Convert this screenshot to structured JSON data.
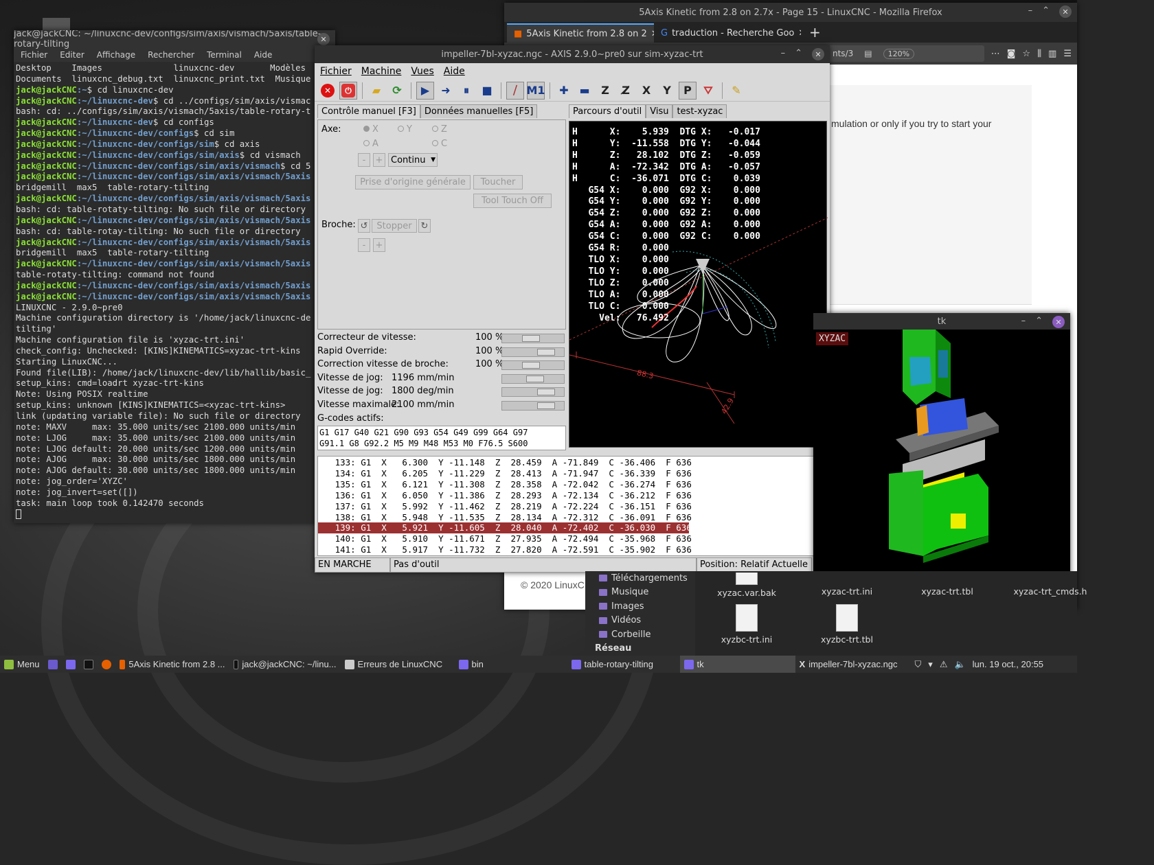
{
  "firefox": {
    "title": "5Axis Kinetic from 2.8 on 2.7x - Page 15 - LinuxCNC - Mozilla Firefox",
    "tabs": [
      "5Axis Kinetic from 2.8 on 2",
      "traduction - Recherche Goo"
    ],
    "url_fragment": "nts/3",
    "zoom": "120%",
    "body_text": "mulation or only if you try to start your",
    "footer": "© 2020 LinuxC"
  },
  "terminal": {
    "title": "jack@jackCNC: ~/linuxcnc-dev/configs/sim/axis/vismach/5axis/table-rotary-tilting",
    "menu": [
      "Fichier",
      "Editer",
      "Affichage",
      "Rechercher",
      "Terminal",
      "Aide"
    ],
    "lines": [
      {
        "t": "Desktop    Images              linuxcnc-dev       Modèles"
      },
      {
        "t": "Documents  linuxcnc_debug.txt  linuxcnc_print.txt  Musique"
      },
      {
        "p": "jack@jackCNC",
        "d": ":~",
        "c": "$ cd linuxcnc-dev"
      },
      {
        "p": "jack@jackCNC",
        "d": ":~/linuxcnc-dev",
        "c": "$ cd ../configs/sim/axis/vismac"
      },
      {
        "t": "bash: cd: ../configs/sim/axis/vismach/5axis/table-rotary-t"
      },
      {
        "p": "jack@jackCNC",
        "d": ":~/linuxcnc-dev",
        "c": "$ cd configs"
      },
      {
        "p": "jack@jackCNC",
        "d": ":~/linuxcnc-dev/configs",
        "c": "$ cd sim"
      },
      {
        "p": "jack@jackCNC",
        "d": ":~/linuxcnc-dev/configs/sim",
        "c": "$ cd axis"
      },
      {
        "p": "jack@jackCNC",
        "d": ":~/linuxcnc-dev/configs/sim/axis",
        "c": "$ cd vismach"
      },
      {
        "p": "jack@jackCNC",
        "d": ":~/linuxcnc-dev/configs/sim/axis/vismach",
        "c": "$ cd 5"
      },
      {
        "p": "jack@jackCNC",
        "d": ":~/linuxcnc-dev/configs/sim/axis/vismach/5axis",
        "c": ""
      },
      {
        "t": "bridgemill  max5  table-rotary-tilting"
      },
      {
        "p": "jack@jackCNC",
        "d": ":~/linuxcnc-dev/configs/sim/axis/vismach/5axis",
        "c": ""
      },
      {
        "t": "bash: cd: table-rotaty-tilting: No such file or directory"
      },
      {
        "p": "jack@jackCNC",
        "d": ":~/linuxcnc-dev/configs/sim/axis/vismach/5axis",
        "c": ""
      },
      {
        "t": "bash: cd: table-rotay-tilting: No such file or directory"
      },
      {
        "p": "jack@jackCNC",
        "d": ":~/linuxcnc-dev/configs/sim/axis/vismach/5axis",
        "c": ""
      },
      {
        "t": "bridgemill  max5  table-rotary-tilting"
      },
      {
        "p": "jack@jackCNC",
        "d": ":~/linuxcnc-dev/configs/sim/axis/vismach/5axis",
        "c": ""
      },
      {
        "t": "table-rotaty-tilting: command not found"
      },
      {
        "p": "jack@jackCNC",
        "d": ":~/linuxcnc-dev/configs/sim/axis/vismach/5axis",
        "c": ""
      },
      {
        "p": "jack@jackCNC",
        "d": ":~/linuxcnc-dev/configs/sim/axis/vismach/5axis",
        "c": ""
      },
      {
        "t": "LINUXCNC - 2.9.0~pre0"
      },
      {
        "t": "Machine configuration directory is '/home/jack/linuxcnc-de"
      },
      {
        "t": "tilting'"
      },
      {
        "t": "Machine configuration file is 'xyzac-trt.ini'"
      },
      {
        "t": "check_config: Unchecked: [KINS]KINEMATICS=xyzac-trt-kins"
      },
      {
        "t": "Starting LinuxCNC..."
      },
      {
        "t": "Found file(LIB): /home/jack/linuxcnc-dev/lib/hallib/basic_"
      },
      {
        "t": "setup_kins: cmd=loadrt xyzac-trt-kins"
      },
      {
        "t": "Note: Using POSIX realtime"
      },
      {
        "t": "setup_kins: unknown [KINS]KINEMATICS=<xyzac-trt-kins>"
      },
      {
        "t": "link (updating variable file): No such file or directory"
      },
      {
        "t": "note: MAXV     max: 35.000 units/sec 2100.000 units/min"
      },
      {
        "t": "note: LJOG     max: 35.000 units/sec 2100.000 units/min"
      },
      {
        "t": "note: LJOG default: 20.000 units/sec 1200.000 units/min"
      },
      {
        "t": "note: AJOG     max: 30.000 units/sec 1800.000 units/min"
      },
      {
        "t": "note: AJOG default: 30.000 units/sec 1800.000 units/min"
      },
      {
        "t": "note: jog_order='XYZC'"
      },
      {
        "t": "note: jog_invert=set([])"
      },
      {
        "t": "task: main loop took 0.142470 seconds"
      }
    ]
  },
  "axis": {
    "title": "impeller-7bl-xyzac.ngc - AXIS 2.9.0~pre0 sur sim-xyzac-trt",
    "menu": [
      "Fichier",
      "Machine",
      "Vues",
      "Aide"
    ],
    "tabs_left": [
      "Contrôle manuel [F3]",
      "Données manuelles [F5]"
    ],
    "tabs_right": [
      "Parcours d'outil",
      "Visu",
      "test-xyzac"
    ],
    "axe_label": "Axe:",
    "axes": [
      "X",
      "Y",
      "Z",
      "A",
      "C"
    ],
    "jog_mode": "Continu",
    "home_all": "Prise d'origine générale",
    "touch": "Toucher",
    "tool_touch_off": "Tool Touch Off",
    "broche_label": "Broche:",
    "stop": "Stopper",
    "minus": "-",
    "plus": "+",
    "overrides": [
      {
        "label": "Correcteur de vitesse:",
        "value": "100 %",
        "pos": 0.45
      },
      {
        "label": "Rapid Override:",
        "value": "100 %",
        "pos": 0.8
      },
      {
        "label": "Correction vitesse de broche:",
        "value": "100 %",
        "pos": 0.45
      },
      {
        "label": "Vitesse de jog:",
        "value": "1196 mm/min",
        "pos": 0.55
      },
      {
        "label": "Vitesse de jog:",
        "value": "1800 deg/min",
        "pos": 0.8
      },
      {
        "label": "Vitesse maximale:",
        "value": "2100 mm/min",
        "pos": 0.8
      }
    ],
    "gcodes_label": "G-codes actifs:",
    "gcodes": [
      "G1 G17 G40 G21 G90 G93 G54 G49 G99 G64 G97",
      "G91.1 G8 G92.2 M5 M9 M48 M53 M0 F76.5 S600"
    ],
    "dro": [
      "H      X:    5.939  DTG X:   -0.017",
      "H      Y:  -11.558  DTG Y:   -0.044",
      "H      Z:   28.102  DTG Z:   -0.059",
      "H      A:  -72.342  DTG A:   -0.057",
      "H      C:  -36.071  DTG C:    0.039",
      "   G54 X:    0.000  G92 X:    0.000",
      "   G54 Y:    0.000  G92 Y:    0.000",
      "   G54 Z:    0.000  G92 Z:    0.000",
      "   G54 A:    0.000  G92 A:    0.000",
      "   G54 C:    0.000  G92 C:    0.000",
      "   G54 R:    0.000",
      "   TLO X:    0.000",
      "   TLO Y:    0.000",
      "   TLO Z:    0.000",
      "   TLO A:    0.000",
      "   TLO C:    0.000",
      "     Vel:   76.492"
    ],
    "dim1": "88.3",
    "dim2": "42.9",
    "listing": [
      "   133: G1  X   6.300  Y -11.148  Z  28.459  A -71.849  C -36.406  F 636",
      "   134: G1  X   6.205  Y -11.229  Z  28.413  A -71.947  C -36.339  F 636",
      "   135: G1  X   6.121  Y -11.308  Z  28.358  A -72.042  C -36.274  F 636",
      "   136: G1  X   6.050  Y -11.386  Z  28.293  A -72.134  C -36.212  F 636",
      "   137: G1  X   5.992  Y -11.462  Z  28.219  A -72.224  C -36.151  F 636",
      "   138: G1  X   5.948  Y -11.535  Z  28.134  A -72.312  C -36.091  F 636",
      "   139: G1  X   5.921  Y -11.605  Z  28.040  A -72.402  C -36.030  F 636",
      "   140: G1  X   5.910  Y -11.671  Z  27.935  A -72.494  C -35.968  F 636",
      "   141: G1  X   5.917  Y -11.732  Z  27.820  A -72.591  C -35.902  F 636"
    ],
    "status": [
      "EN MARCHE",
      "Pas d'outil",
      "Position: Relatif Actuelle"
    ]
  },
  "tk": {
    "title": "tk",
    "label": "XYZAC"
  },
  "filemanager": {
    "places": [
      "Téléchargements",
      "Musique",
      "Images",
      "Vidéos",
      "Corbeille",
      "Réseau"
    ],
    "files": [
      "xyzac.var.bak",
      "xyzac-trt.ini",
      "xyzac-trt.tbl",
      "xyzac-trt_cmds.h",
      "xyzbc-trt.ini",
      "xyzbc-trt.tbl"
    ]
  },
  "taskbar": {
    "menu": "Menu",
    "items": [
      "5Axis Kinetic from 2.8 ...",
      "jack@jackCNC: ~/linu...",
      "Erreurs de LinuxCNC",
      "bin",
      "table-rotary-tilting",
      "tk",
      "impeller-7bl-xyzac.ngc"
    ],
    "clock": "lun. 19 oct., 20:55"
  }
}
